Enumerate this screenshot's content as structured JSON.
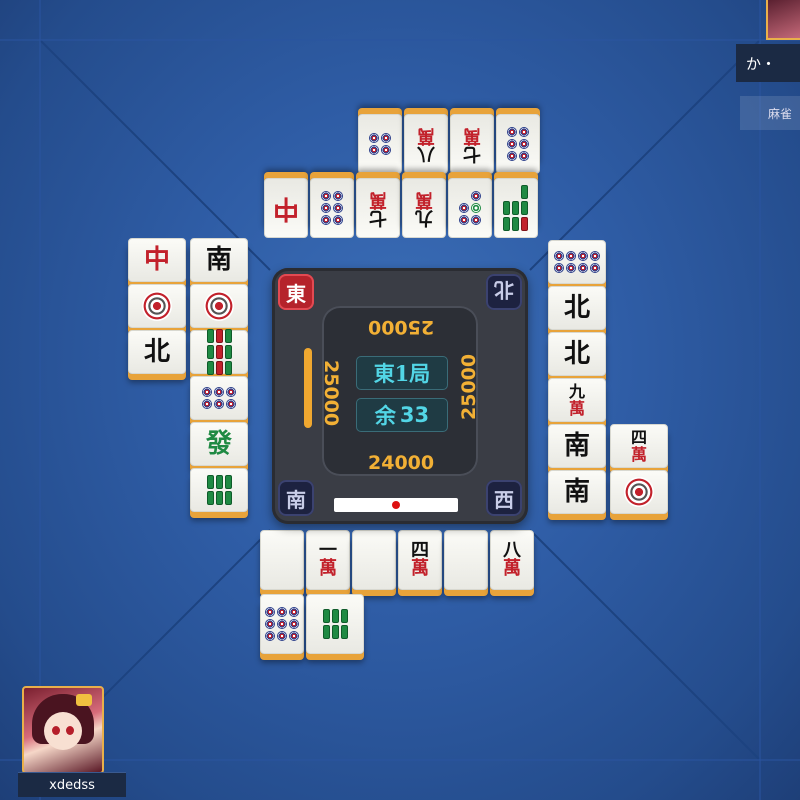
{
  "console": {
    "winds": {
      "top": "北",
      "bottom": "南",
      "left": "東",
      "right": "西"
    },
    "scores": {
      "top": "25000",
      "left": "25000",
      "right": "25000",
      "bottom": "24000"
    },
    "round": "東1局",
    "remaining_label": "余",
    "remaining_count": "33"
  },
  "player": {
    "name": "xdedss"
  },
  "opponent_top_right": {
    "name": "か・",
    "sub": "麻雀"
  },
  "tiles": {
    "top_row1": [
      "8p",
      "8m",
      "7m",
      "6p"
    ],
    "top_row2": [
      "中",
      "6p",
      "7m",
      "9m",
      "5p",
      "7s"
    ],
    "left_col1": [
      "中",
      "1p",
      "北"
    ],
    "left_col2": [
      "南",
      "1p",
      "9s",
      "6p",
      "發",
      "6s"
    ],
    "right_col1": [
      "8p",
      "北",
      "北",
      "9m",
      "南",
      "南"
    ],
    "right_col2": [
      "4m",
      "1p"
    ],
    "bottom_row1": [
      "",
      "一萬",
      "",
      "四萬",
      "",
      "八萬"
    ],
    "bottom_row2": [
      "9p",
      "6s"
    ]
  },
  "labels": {
    "man": "萬",
    "one": "一",
    "four": "四",
    "eight": "八",
    "chun": "中",
    "hatsu": "發",
    "nan": "南",
    "pei": "北",
    "seven": "七",
    "nine": "九"
  }
}
